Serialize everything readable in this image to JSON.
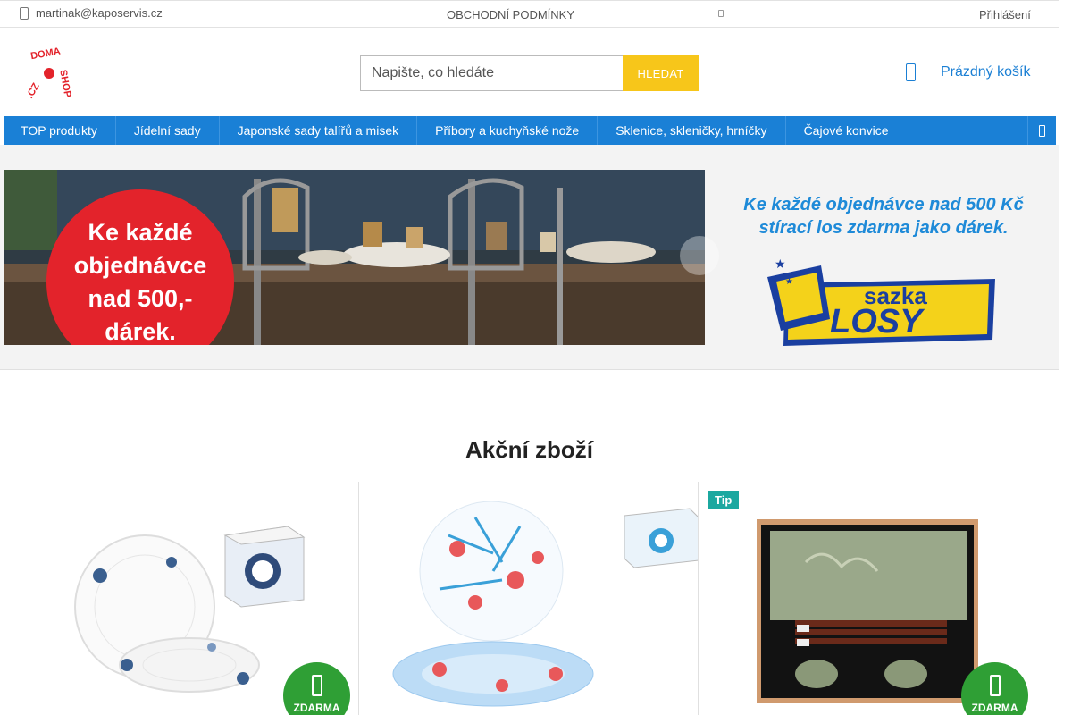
{
  "topbar": {
    "email": "martinak@kaposervis.cz",
    "terms": "OBCHODNÍ PODMÍNKY",
    "login": "Přihlášení"
  },
  "logo": {
    "text": "DOMA·SHOP·CZ"
  },
  "search": {
    "placeholder": "Napište, co hledáte",
    "button": "HLEDAT"
  },
  "cart": {
    "label": "Prázdný košík"
  },
  "nav": {
    "items": [
      {
        "label": "TOP produkty"
      },
      {
        "label": "Jídelní sady"
      },
      {
        "label": "Japonské sady talířů a misek"
      },
      {
        "label": "Příbory a kuchyňské nože"
      },
      {
        "label": "Sklenice, skleničky, hrníčky"
      },
      {
        "label": "Čajové konvice"
      }
    ]
  },
  "banner": {
    "main_line1": "Ke každé",
    "main_line2": "objednávce",
    "main_line3": "nad 500,-",
    "main_line4": "dárek.",
    "side_line1": "Ke každé objednávce nad 500 Kč",
    "side_line2": "stírací los zdarma jako dárek.",
    "sazka": "sazka",
    "losy": "LOSY"
  },
  "section": {
    "title": "Akční zboží"
  },
  "products": [
    {
      "badge": "ZDARMA"
    },
    {
      "badge": ""
    },
    {
      "tag": "Tip",
      "badge": "ZDARMA"
    }
  ],
  "colors": {
    "nav": "#1a80d6",
    "search_button": "#f7c61a",
    "cart_link": "#1a7fd4",
    "promo_red": "#e3232b",
    "free_badge": "#2f9f35",
    "tip_tag": "#1ba8a0"
  }
}
